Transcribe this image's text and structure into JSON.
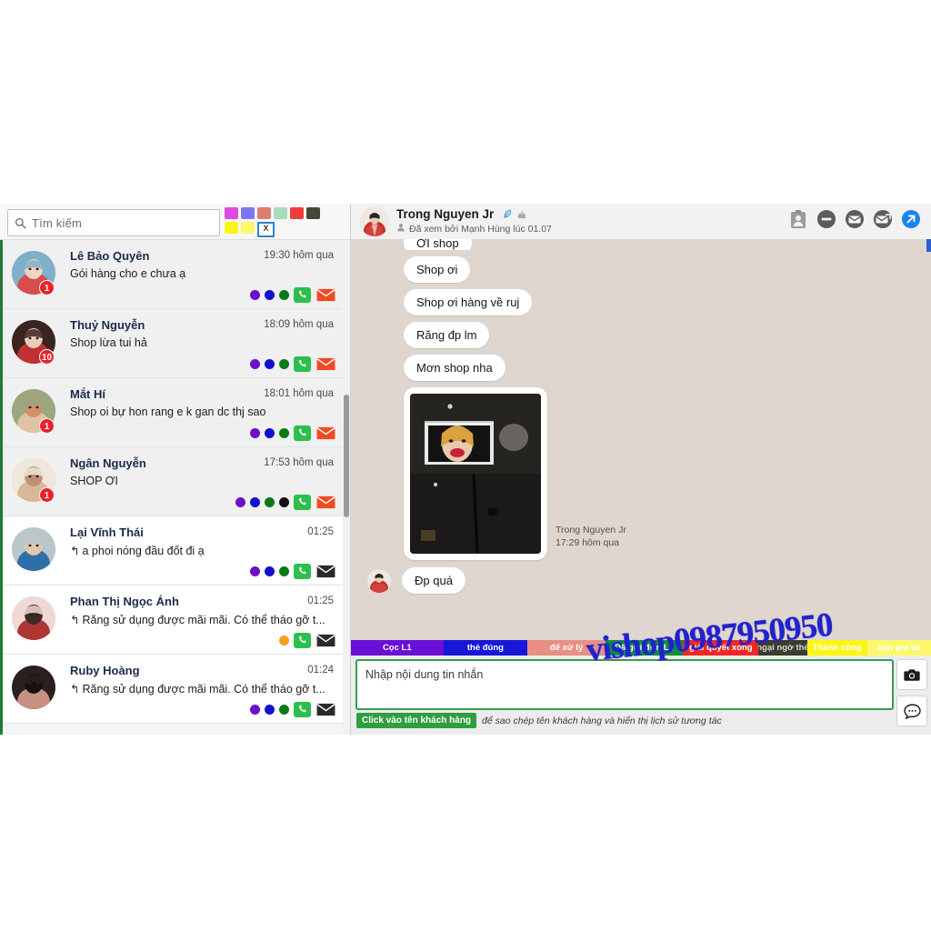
{
  "search": {
    "placeholder": "Tìm kiếm",
    "icon": "search-icon"
  },
  "swatches": {
    "row1": [
      "#e04ae0",
      "#7b77ee",
      "#df7f72",
      "#a6dcbc",
      "#f23c3c",
      "#474735"
    ],
    "row2": [
      "#fbf516",
      "#fbf96a"
    ],
    "close_label": "X"
  },
  "conversations": [
    {
      "name": "Lê Bảo Quyên",
      "time": "19:30 hôm qua",
      "message": "Gói hàng cho e chưa ạ",
      "reply": false,
      "badge": "1",
      "row_bg": "#f0f0f0",
      "dots": [
        "#6a11c9",
        "#1111cc",
        "#0a7a16"
      ],
      "mail_color": "#f04a23",
      "avatar": [
        "#7fb0c8",
        "#d94c4c",
        "#f0d6c0"
      ]
    },
    {
      "name": "Thuỷ Nguyễn",
      "time": "18:09 hôm qua",
      "message": "Shop lừa tui hả",
      "reply": false,
      "badge": "10",
      "row_bg": "#f0f0f0",
      "dots": [
        "#6a11c9",
        "#1111cc",
        "#0a7a16"
      ],
      "mail_color": "#f04a23",
      "avatar": [
        "#3a2420",
        "#c23030",
        "#e7cdbe"
      ]
    },
    {
      "name": "Mắt Hí",
      "time": "18:01 hôm qua",
      "message": "Shop oi bự hon rang e k gan dc thj sao",
      "reply": false,
      "badge": "1",
      "row_bg": "#f0f0f0",
      "dots": [
        "#6a11c9",
        "#1111cc",
        "#0a7a16"
      ],
      "mail_color": "#f04a23",
      "avatar": [
        "#9aa77f",
        "#e0c2a4",
        "#cf8f6d"
      ]
    },
    {
      "name": "Ngân Nguyễn",
      "time": "17:53 hôm qua",
      "message": "SHOP ƠI",
      "reply": false,
      "badge": "1",
      "row_bg": "#f0f0f0",
      "dots": [
        "#6a11c9",
        "#1111cc",
        "#0a7a16",
        "#111111"
      ],
      "mail_color": "#f04a23",
      "avatar": [
        "#efe6dc",
        "#d8b79a",
        "#bf9076"
      ]
    },
    {
      "name": "Lại Vĩnh Thái",
      "time": "01:25",
      "message": "a phoi nóng đầu đốt đi ạ",
      "reply": true,
      "badge": "",
      "row_bg": "#ffffff",
      "dots": [
        "#6a11c9",
        "#1111cc",
        "#0a7a16"
      ],
      "mail_color": "#2a2a2a",
      "avatar": [
        "#b9c7cd",
        "#2f6fa8",
        "#e0c8ac"
      ]
    },
    {
      "name": "Phan Thị Ngọc Ánh",
      "time": "01:25",
      "message": "Răng sử dụng được mãi mãi. Có thể tháo gỡ t...",
      "reply": true,
      "badge": "",
      "row_bg": "#ffffff",
      "dots": [
        "#f5a11a"
      ],
      "mail_color": "#2a2a2a",
      "avatar": [
        "#f0d9d5",
        "#b03535",
        "#3a2a28"
      ]
    },
    {
      "name": "Ruby Hoàng",
      "time": "01:24",
      "message": "Răng sử dụng được mãi mãi. Có thể tháo gỡ t...",
      "reply": true,
      "badge": "",
      "row_bg": "#ffffff",
      "dots": [
        "#6a11c9",
        "#1111cc",
        "#0a7a16"
      ],
      "mail_color": "#2a2a2a",
      "avatar": [
        "#2b2020",
        "#c98f82",
        "#161010"
      ]
    }
  ],
  "chat_header": {
    "name": "Trong Nguyen Jr",
    "subtitle": "Đã xem bởi Mạnh Hùng lúc 01.07",
    "inline_icons": [
      "leaf-icon",
      "cake-icon"
    ],
    "sub_icon": "person-icon",
    "actions": [
      "contact-card-icon",
      "minus-circle-icon",
      "envelope-circle-icon",
      "envelope-arrow-circle-icon",
      "send-arrow-icon"
    ]
  },
  "messages": [
    {
      "text": "ƠI shop",
      "type": "text",
      "cut": true
    },
    {
      "text": "Shop ơi",
      "type": "text"
    },
    {
      "text": "Shop ơi hàng về ruj",
      "type": "text"
    },
    {
      "text": "Răng đp lm",
      "type": "text"
    },
    {
      "text": "Mơn shop nha",
      "type": "text"
    },
    {
      "text": "",
      "type": "image",
      "sender": "Trong Nguyen Jr",
      "time": "17:29 hôm qua"
    },
    {
      "text": "Đp quá",
      "type": "text",
      "with_avatar": true
    }
  ],
  "tags": [
    {
      "label": "Cọc L1",
      "bg": "#6a0fd6",
      "fg": "#ffffff",
      "width": 114
    },
    {
      "label": "thẻ đúng",
      "bg": "#1717d8",
      "fg": "#ffffff",
      "width": 104
    },
    {
      "label": "để xử lý",
      "bg": "#e88f85",
      "fg": "#ffffff",
      "width": 96
    },
    {
      "label": "Đã gửi đơn L1",
      "bg": "#0d8f3f",
      "fg": "#ffffff",
      "width": 96
    },
    {
      "label": "giải quyết xong",
      "bg": "#ee2828",
      "fg": "#ffffff",
      "width": 93
    },
    {
      "label": "ngại ngờ thẻ",
      "bg": "#3b3b33",
      "fg": "#d8d8c8",
      "width": 60
    },
    {
      "label": "Thành công",
      "bg": "#fbf516",
      "fg": "#ffffff",
      "width": 74
    },
    {
      "label": "ban goi lai",
      "bg": "#fbf96a",
      "fg": "#ffffff",
      "width": 79
    }
  ],
  "composer": {
    "placeholder": "Nhập nội dung tin nhắn",
    "hint_button": "Click vào tên khách hàng",
    "hint_text": "để sao chép tên khách hàng và hiển thị lịch sử tương tác",
    "side_buttons": [
      "camera-icon",
      "chat-bubble-icon"
    ]
  },
  "watermark": {
    "text": "vishop0987950950",
    "color": "#2222cc"
  }
}
